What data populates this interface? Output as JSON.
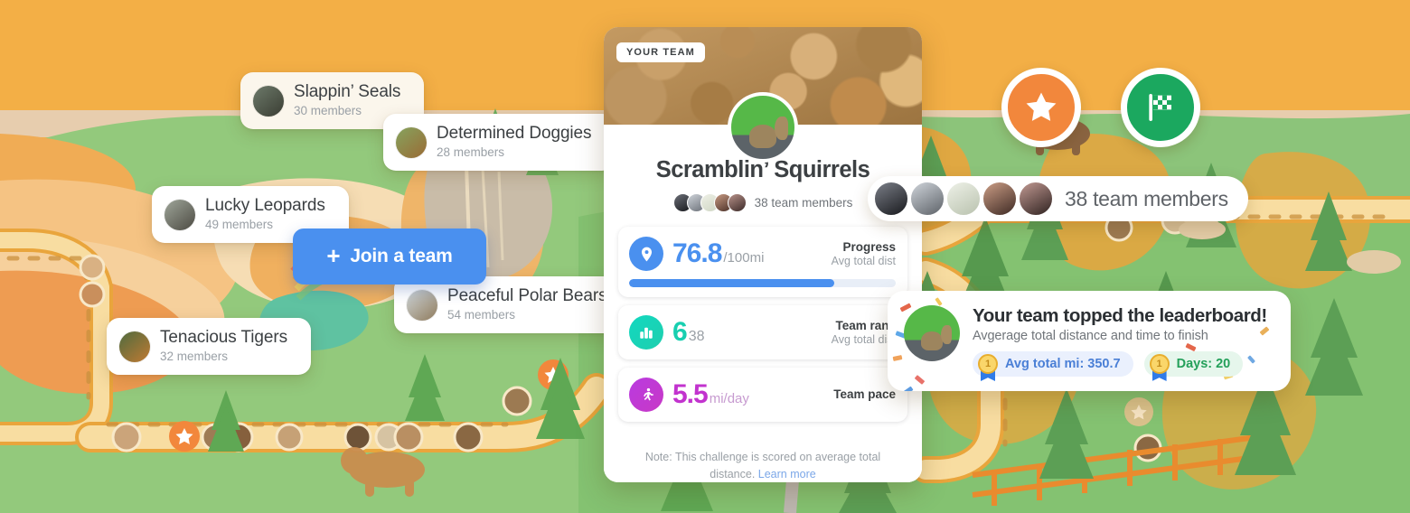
{
  "background": {
    "name": "illustrated-trail-map",
    "sky_color": "#F3AF46",
    "grass_color": "#7FC06A",
    "trail_color": "#F8DDA1",
    "trail_border_color": "#E9A53C"
  },
  "team_cards": [
    {
      "name": "Slappin’ Seals",
      "members": "30 members",
      "avatar": "seal-avatar",
      "tint": "#FBF6EC"
    },
    {
      "name": "Determined Doggies",
      "members": "28 members",
      "avatar": "dog-avatar",
      "tint": "#FFFFFF"
    },
    {
      "name": "Lucky Leopards",
      "members": "49 members",
      "avatar": "leopard-avatar",
      "tint": "#FFFFFF"
    },
    {
      "name": "Peaceful Polar Bears",
      "members": "54 members",
      "avatar": "bear-avatar",
      "tint": "#FFFFFF"
    },
    {
      "name": "Tenacious Tigers",
      "members": "32 members",
      "avatar": "tiger-avatar",
      "tint": "#FFFFFF"
    }
  ],
  "join_button": {
    "icon": "plus-icon",
    "label": "Join a team",
    "color": "#4A90EF"
  },
  "main_card": {
    "badge": "YOUR TEAM",
    "hero_image": "acorns-photo",
    "team_avatar": "squirrel-avatar",
    "title": "Scramblin’ Squirrels",
    "members_count": "38 team members",
    "stats": [
      {
        "icon": "location-pin-icon",
        "value": "76.8",
        "unit": "/100mi",
        "label": "Progress",
        "sublabel": "Avg total dist",
        "progress_percent": 76.8,
        "color": "#4A90EF"
      },
      {
        "icon": "bar-chart-icon",
        "value": "6",
        "unit": "38",
        "label": "Team rank",
        "sublabel": "Avg total dist",
        "color": "#18CFB0"
      },
      {
        "icon": "runner-icon",
        "value": "5.5",
        "unit": "mi/day",
        "label": "Team pace",
        "sublabel": "",
        "color": "#C233CE"
      }
    ],
    "note_text": "Note: This challenge is scored on average total distance.",
    "note_link": "Learn more"
  },
  "members_pill": {
    "count_text": "38 team members",
    "avatars": 5
  },
  "round_badges": [
    {
      "icon": "star-icon",
      "color": "#F2873C"
    },
    {
      "icon": "checkered-flag-icon",
      "color": "#1BA85F"
    }
  ],
  "toast": {
    "avatar": "squirrel-avatar",
    "title": "Your team topped the leaderboard!",
    "subtitle": "Avgerage total distance and time to finish",
    "chips": [
      {
        "medal": "1",
        "label": "Avg total mi: 350.7",
        "style": "blue"
      },
      {
        "medal": "1",
        "label": "Days: 20",
        "style": "green"
      }
    ]
  }
}
